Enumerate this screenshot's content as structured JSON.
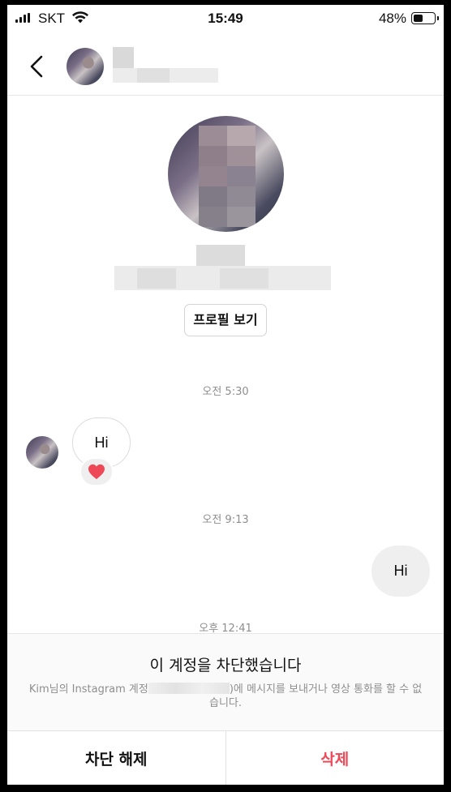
{
  "status_bar": {
    "carrier": "SKT",
    "time": "15:49",
    "battery_percent": "48%",
    "battery_level": 0.48,
    "signal_icon": "signal-bars-icon",
    "wifi_icon": "wifi-icon"
  },
  "header": {
    "back_icon": "chevron-left-icon"
  },
  "profile": {
    "view_profile_label": "프로필 보기"
  },
  "messages": {
    "timestamp_1": "오전 5:30",
    "incoming_text": "Hi",
    "reaction_icon": "heart-icon",
    "reaction_color": "#ed4956",
    "timestamp_2": "오전 9:13",
    "outgoing_text": "Hi",
    "timestamp_3": "오후 12:41"
  },
  "blocked_notice": {
    "title": "이 계정을 차단했습니다",
    "desc_prefix": "Kim님의 Instagram 계정",
    "desc_suffix": ")에 메시지를 보내거나 영상 통화를 할 수 없습니다."
  },
  "actions": {
    "unblock_label": "차단 해제",
    "delete_label": "삭제",
    "delete_color": "#ed4956"
  }
}
